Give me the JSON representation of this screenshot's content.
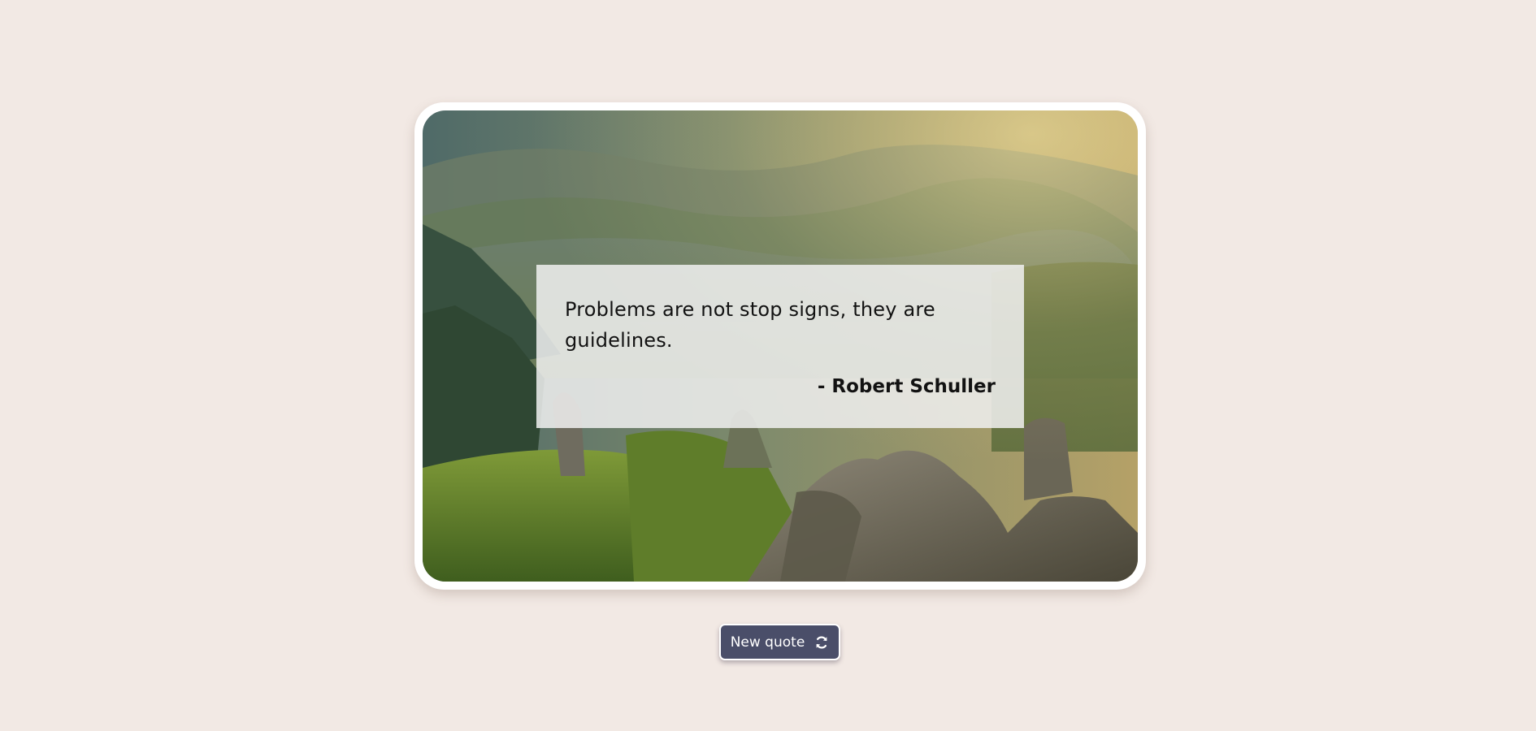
{
  "quote": {
    "text": "Problems are not stop signs, they are guidelines.",
    "author": "- Robert Schuller"
  },
  "controls": {
    "new_quote_label": "New quote",
    "new_quote_icon": "refresh-icon"
  },
  "colors": {
    "page_background": "#f2e9e4",
    "card_border": "#ffffff",
    "button_background": "#4a4e69",
    "button_text": "#ffffff"
  },
  "background_image": {
    "icon": "mountain-landscape-photo"
  }
}
